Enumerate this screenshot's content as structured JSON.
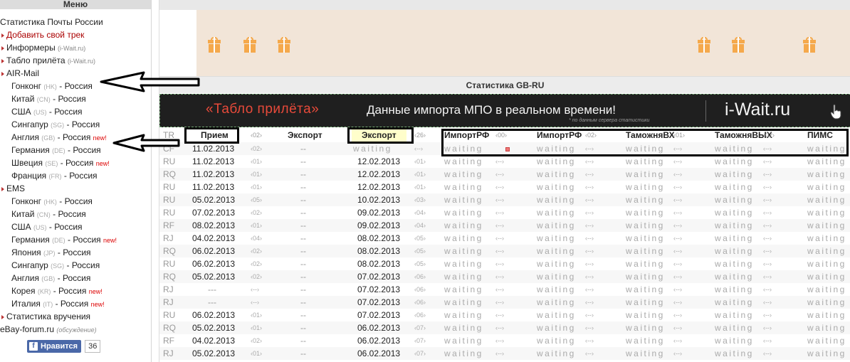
{
  "menu": {
    "header": "Меню",
    "items": [
      {
        "kind": "title",
        "label": "Статистика Почты России"
      },
      {
        "kind": "top",
        "label": "Добавить свой трек",
        "red": true
      },
      {
        "kind": "top",
        "label": "Информеры",
        "note": "(i-Wait.ru)"
      },
      {
        "kind": "top",
        "label": "Табло прилёта",
        "note": "(i-Wait.ru)"
      },
      {
        "kind": "top",
        "label": "AIR-Mail"
      },
      {
        "kind": "sub",
        "label": "Гонконг",
        "cc": "(HK)",
        "to": "- Россия"
      },
      {
        "kind": "sub",
        "label": "Китай",
        "cc": "(CN)",
        "to": "- Россия"
      },
      {
        "kind": "sub",
        "label": "США",
        "cc": "(US)",
        "to": "- Россия"
      },
      {
        "kind": "sub",
        "label": "Сингапур",
        "cc": "(SG)",
        "to": "- Россия"
      },
      {
        "kind": "sub",
        "label": "Англия",
        "cc": "(GB)",
        "to": "- Россия",
        "new": "new!"
      },
      {
        "kind": "sub",
        "label": "Германия",
        "cc": "(DE)",
        "to": "- Россия"
      },
      {
        "kind": "sub",
        "label": "Швеция",
        "cc": "(SE)",
        "to": "- Россия",
        "new": "new!"
      },
      {
        "kind": "sub",
        "label": "Франция",
        "cc": "(FR)",
        "to": "- Россия"
      },
      {
        "kind": "top",
        "label": "EMS"
      },
      {
        "kind": "sub",
        "label": "Гонконг",
        "cc": "(HK)",
        "to": "- Россия"
      },
      {
        "kind": "sub",
        "label": "Китай",
        "cc": "(CN)",
        "to": "- Россия"
      },
      {
        "kind": "sub",
        "label": "США",
        "cc": "(US)",
        "to": "- Россия"
      },
      {
        "kind": "sub",
        "label": "Германия",
        "cc": "(DE)",
        "to": "- Россия",
        "new": "new!"
      },
      {
        "kind": "sub",
        "label": "Япония",
        "cc": "(JP)",
        "to": "- Россия"
      },
      {
        "kind": "sub",
        "label": "Сингапур",
        "cc": "(SG)",
        "to": "- Россия"
      },
      {
        "kind": "sub",
        "label": "Англия",
        "cc": "(GB)",
        "to": "- Россия"
      },
      {
        "kind": "sub",
        "label": "Корея",
        "cc": "(KR)",
        "to": "- Россия",
        "new": "new!"
      },
      {
        "kind": "sub",
        "label": "Италия",
        "cc": "(IT)",
        "to": "- Россия",
        "new": "new!"
      },
      {
        "kind": "top",
        "label": "Статистика вручения"
      },
      {
        "kind": "title",
        "label": "eBay-forum.ru",
        "note": "(обсуждение)"
      }
    ],
    "like": {
      "label": "Нравится",
      "fb": "f",
      "count": "36"
    }
  },
  "main": {
    "stats_title": "Статистика GB-RU",
    "iw_banner": {
      "left": "«Табло прилёта»",
      "mid": "Данные импорта МПО в реальном времени!",
      "note": "* по данным сервера статистики",
      "right": "i-Wait.ru"
    },
    "table": {
      "header": {
        "code": "TR",
        "recv": "Прием",
        "d1": "‹02›",
        "exp": "Экспорт",
        "exp2": "Экспорт",
        "d2": "‹26›",
        "groups": [
          {
            "label": "ИмпортРФ",
            "delta": "‹00›"
          },
          {
            "label": "ИмпортРФ",
            "delta": "‹02›"
          },
          {
            "label": "ТаможняВХ",
            "delta": "‹01›"
          },
          {
            "label": "ТаможняВЫХ",
            "delta": "‹02›"
          },
          {
            "label": "ПИМС",
            "delta": ""
          }
        ]
      },
      "waiting": "waiting",
      "dash": "‹--›",
      "rows": [
        {
          "code": "CF",
          "recv": "11.02.2013",
          "d1": "‹02›",
          "exp": "--",
          "exp2": "waiting",
          "d2": "‹--›"
        },
        {
          "code": "RU",
          "recv": "11.02.2013",
          "d1": "‹01›",
          "exp": "--",
          "exp2": "12.02.2013",
          "d2": "‹01›"
        },
        {
          "code": "RQ",
          "recv": "11.02.2013",
          "d1": "‹01›",
          "exp": "--",
          "exp2": "12.02.2013",
          "d2": "‹01›"
        },
        {
          "code": "RU",
          "recv": "11.02.2013",
          "d1": "‹01›",
          "exp": "--",
          "exp2": "12.02.2013",
          "d2": "‹01›"
        },
        {
          "code": "RU",
          "recv": "05.02.2013",
          "d1": "‹05›",
          "exp": "--",
          "exp2": "10.02.2013",
          "d2": "‹03›"
        },
        {
          "code": "RU",
          "recv": "07.02.2013",
          "d1": "‹02›",
          "exp": "--",
          "exp2": "09.02.2013",
          "d2": "‹04›"
        },
        {
          "code": "RF",
          "recv": "08.02.2013",
          "d1": "‹01›",
          "exp": "--",
          "exp2": "09.02.2013",
          "d2": "‹04›"
        },
        {
          "code": "RJ",
          "recv": "04.02.2013",
          "d1": "‹04›",
          "exp": "--",
          "exp2": "08.02.2013",
          "d2": "‹05›"
        },
        {
          "code": "RQ",
          "recv": "06.02.2013",
          "d1": "‹02›",
          "exp": "--",
          "exp2": "08.02.2013",
          "d2": "‹05›"
        },
        {
          "code": "RU",
          "recv": "06.02.2013",
          "d1": "‹02›",
          "exp": "--",
          "exp2": "08.02.2013",
          "d2": "‹05›"
        },
        {
          "code": "RQ",
          "recv": "05.02.2013",
          "d1": "‹02›",
          "exp": "--",
          "exp2": "07.02.2013",
          "d2": "‹06›"
        },
        {
          "code": "RJ",
          "recv": "---",
          "d1": "‹--›",
          "exp": "--",
          "exp2": "07.02.2013",
          "d2": "‹06›"
        },
        {
          "code": "RJ",
          "recv": "---",
          "d1": "‹--›",
          "exp": "--",
          "exp2": "07.02.2013",
          "d2": "‹06›"
        },
        {
          "code": "RU",
          "recv": "06.02.2013",
          "d1": "‹01›",
          "exp": "--",
          "exp2": "07.02.2013",
          "d2": "‹06›"
        },
        {
          "code": "RQ",
          "recv": "05.02.2013",
          "d1": "‹01›",
          "exp": "--",
          "exp2": "06.02.2013",
          "d2": "‹07›"
        },
        {
          "code": "RF",
          "recv": "04.02.2013",
          "d1": "‹02›",
          "exp": "--",
          "exp2": "06.02.2013",
          "d2": "‹07›"
        },
        {
          "code": "RJ",
          "recv": "05.02.2013",
          "d1": "‹01›",
          "exp": "--",
          "exp2": "06.02.2013",
          "d2": "‹07›"
        }
      ]
    }
  }
}
